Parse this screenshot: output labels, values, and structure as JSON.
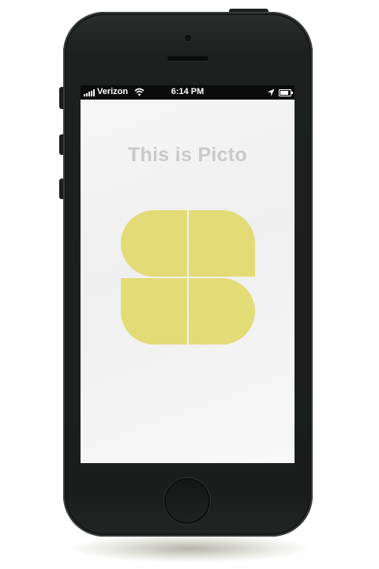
{
  "status_bar": {
    "carrier": "Verizon",
    "time": "6:14 PM"
  },
  "main": {
    "headline": "This is Picto"
  },
  "colors": {
    "logo": "#e2da70",
    "headline": "#c9c9c9",
    "phone_body": "#1c1f1e"
  },
  "icons": [
    "signal-icon",
    "wifi-icon",
    "location-icon",
    "battery-icon",
    "picto-logo"
  ]
}
